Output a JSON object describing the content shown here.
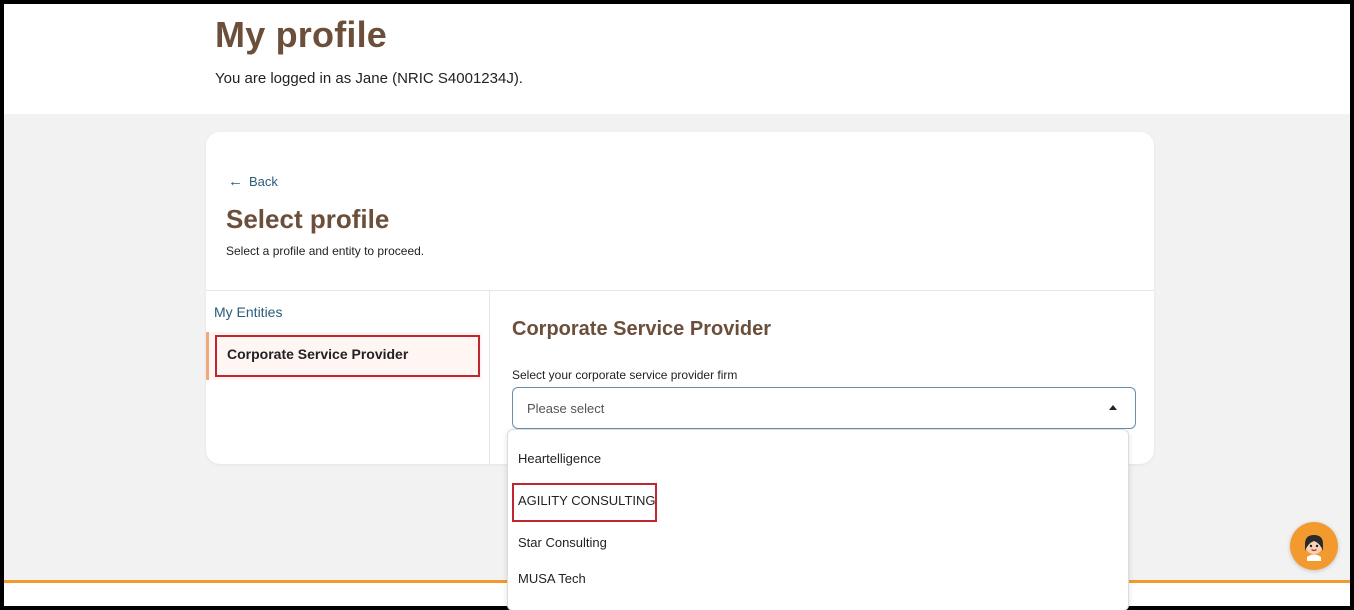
{
  "header": {
    "title": "My profile",
    "logged_in_text": "You are logged in as Jane (NRIC S4001234J)."
  },
  "card": {
    "back_label": "Back",
    "title": "Select profile",
    "subtitle": "Select a profile and entity to proceed.",
    "sidebar": {
      "heading": "My Entities",
      "items": [
        {
          "label": "Corporate Service Provider",
          "selected": true
        }
      ]
    },
    "section": {
      "title": "Corporate Service Provider",
      "field_label": "Select your corporate service provider firm",
      "select_placeholder": "Please select",
      "options": [
        "Heartelligence",
        "AGILITY CONSULTING",
        "Star Consulting",
        "MUSA Tech"
      ]
    }
  },
  "colors": {
    "title_brown": "#6b4f3a",
    "link_blue": "#2b5c7a",
    "accent_orange": "#f39a2e",
    "highlight_red": "#c0262d"
  },
  "icons": {
    "back": "arrow-left-icon",
    "select_caret": "caret-up-icon",
    "chat": "chat-avatar-icon"
  }
}
